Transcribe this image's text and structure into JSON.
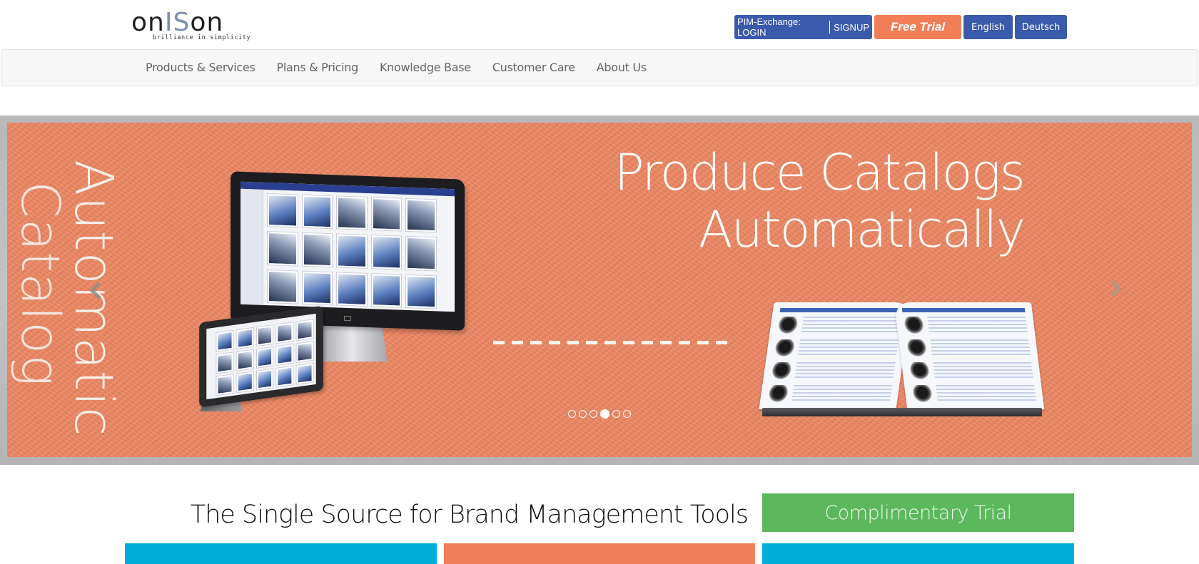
{
  "header": {
    "logo": {
      "text_before": "on",
      "text_accent": "IS",
      "text_after": "on",
      "tagline": "brilliance in simplicity"
    },
    "pim_exchange": {
      "prefix": "PIM-Exchange: LOGIN",
      "signup": "SIGNUP"
    },
    "free_trial": "Free Trial",
    "languages": [
      "English",
      "Deutsch"
    ]
  },
  "nav": {
    "items": [
      "Products & Services",
      "Plans & Pricing",
      "Knowledge Base",
      "Customer Care",
      "About Us"
    ]
  },
  "banner": {
    "vertical_text": [
      "Automatic",
      "Catalog"
    ],
    "headline": [
      "Produce Catalogs",
      "Automatically"
    ],
    "slides_total": 6,
    "active_slide": 4,
    "icons": {
      "prev": "chevron-left-icon",
      "next": "chevron-right-icon"
    }
  },
  "main": {
    "tagline": "The Single Source for Brand Management Tools",
    "cta": "Complimentary Trial"
  },
  "colors": {
    "brand_blue": "#3a5aab",
    "trial_orange": "#f07f58",
    "banner_orange": "#ed8763",
    "cta_green": "#5cb85c",
    "tile_cyan": "#01aed9"
  }
}
